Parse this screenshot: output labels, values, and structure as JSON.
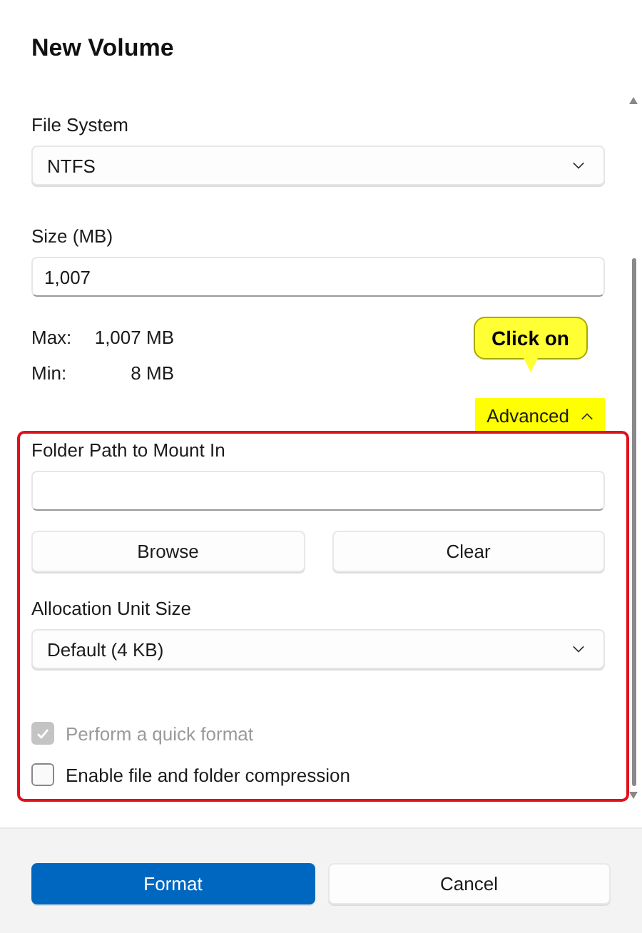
{
  "dialog": {
    "title": "New Volume"
  },
  "file_system": {
    "label": "File System",
    "value": "NTFS"
  },
  "size": {
    "label": "Size (MB)",
    "value": "1,007"
  },
  "limits": [
    {
      "label": "Max:",
      "value": "1,007 MB"
    },
    {
      "label": "Min:",
      "value": "8 MB"
    }
  ],
  "advanced": {
    "label": "Advanced",
    "expanded": true,
    "highlighted": true
  },
  "callout": {
    "text": "Click on"
  },
  "advanced_panel": {
    "outlined": true,
    "folder_path": {
      "label": "Folder Path to Mount In"
    },
    "path_buttons": [
      "Browse",
      "Clear"
    ],
    "allocation": {
      "label": "Allocation Unit Size",
      "value": "Default (4 KB)"
    },
    "options": [
      {
        "label": "Perform a quick format",
        "checked": true,
        "disabled": true
      },
      {
        "label": "Enable file and folder compression",
        "checked": false,
        "disabled": false
      }
    ]
  },
  "buttons": [
    {
      "label": "Format",
      "primary": true
    },
    {
      "label": "Cancel",
      "primary": false
    }
  ]
}
